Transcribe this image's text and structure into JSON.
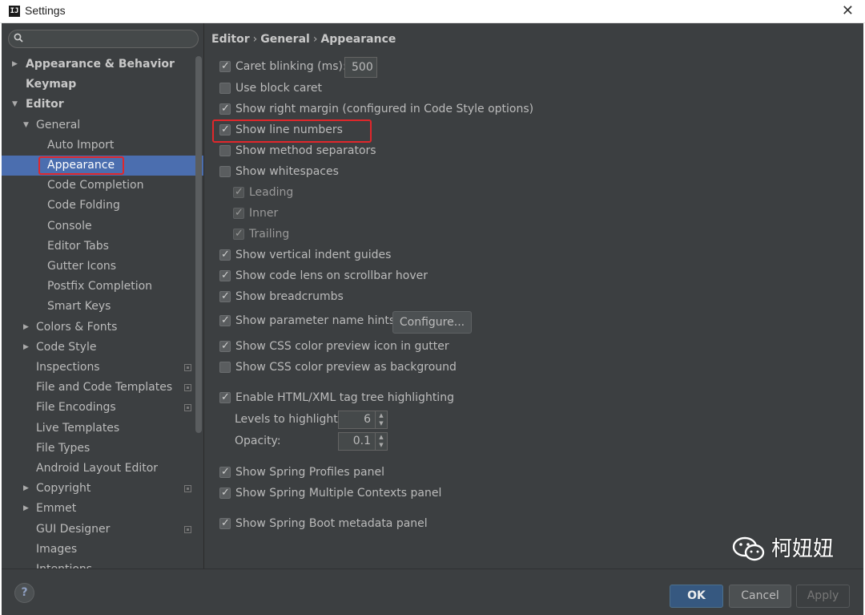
{
  "window": {
    "title": "Settings",
    "close_glyph": "✕",
    "app_icon_letter": "IJ"
  },
  "search": {
    "placeholder": "",
    "icon": "search-icon"
  },
  "sidebar": {
    "items": [
      {
        "label": "Appearance & Behavior",
        "level": 0,
        "arrow": "▶",
        "bold": true
      },
      {
        "label": "Keymap",
        "level": 0,
        "arrow": "",
        "bold": true
      },
      {
        "label": "Editor",
        "level": 0,
        "arrow": "▼",
        "bold": true
      },
      {
        "label": "General",
        "level": 1,
        "arrow": "▼"
      },
      {
        "label": "Auto Import",
        "level": 2,
        "arrow": ""
      },
      {
        "label": "Appearance",
        "level": 2,
        "arrow": "",
        "selected": true
      },
      {
        "label": "Code Completion",
        "level": 2,
        "arrow": ""
      },
      {
        "label": "Code Folding",
        "level": 2,
        "arrow": ""
      },
      {
        "label": "Console",
        "level": 2,
        "arrow": ""
      },
      {
        "label": "Editor Tabs",
        "level": 2,
        "arrow": ""
      },
      {
        "label": "Gutter Icons",
        "level": 2,
        "arrow": ""
      },
      {
        "label": "Postfix Completion",
        "level": 2,
        "arrow": ""
      },
      {
        "label": "Smart Keys",
        "level": 2,
        "arrow": ""
      },
      {
        "label": "Colors & Fonts",
        "level": 1,
        "arrow": "▶"
      },
      {
        "label": "Code Style",
        "level": 1,
        "arrow": "▶"
      },
      {
        "label": "Inspections",
        "level": 1,
        "arrow": "",
        "project_icon": true
      },
      {
        "label": "File and Code Templates",
        "level": 1,
        "arrow": "",
        "project_icon": true
      },
      {
        "label": "File Encodings",
        "level": 1,
        "arrow": "",
        "project_icon": true
      },
      {
        "label": "Live Templates",
        "level": 1,
        "arrow": ""
      },
      {
        "label": "File Types",
        "level": 1,
        "arrow": ""
      },
      {
        "label": "Android Layout Editor",
        "level": 1,
        "arrow": ""
      },
      {
        "label": "Copyright",
        "level": 1,
        "arrow": "▶",
        "project_icon": true
      },
      {
        "label": "Emmet",
        "level": 1,
        "arrow": "▶"
      },
      {
        "label": "GUI Designer",
        "level": 1,
        "arrow": "",
        "project_icon": true
      },
      {
        "label": "Images",
        "level": 1,
        "arrow": ""
      },
      {
        "label": "Intentions",
        "level": 1,
        "arrow": ""
      }
    ]
  },
  "breadcrumb": {
    "parts": [
      "Editor",
      "General",
      "Appearance"
    ],
    "separator": "›"
  },
  "options": {
    "caret_blinking": {
      "label": "Caret blinking (ms):",
      "checked": true,
      "value": "500"
    },
    "use_block_caret": {
      "label": "Use block caret",
      "checked": false
    },
    "show_right_margin": {
      "label": "Show right margin (configured in Code Style options)",
      "checked": true
    },
    "show_line_numbers": {
      "label": "Show line numbers",
      "checked": true
    },
    "show_method_separators": {
      "label": "Show method separators",
      "checked": false
    },
    "show_whitespaces": {
      "label": "Show whitespaces",
      "checked": false
    },
    "leading": {
      "label": "Leading",
      "checked": true,
      "disabled": true
    },
    "inner": {
      "label": "Inner",
      "checked": true,
      "disabled": true
    },
    "trailing": {
      "label": "Trailing",
      "checked": true,
      "disabled": true
    },
    "vertical_indent_guides": {
      "label": "Show vertical indent guides",
      "checked": true
    },
    "code_lens": {
      "label": "Show code lens on scrollbar hover",
      "checked": true
    },
    "breadcrumbs": {
      "label": "Show breadcrumbs",
      "checked": true
    },
    "param_hints": {
      "label": "Show parameter name hints",
      "checked": true,
      "button": "Configure..."
    },
    "css_icon": {
      "label": "Show CSS color preview icon in gutter",
      "checked": true
    },
    "css_background": {
      "label": "Show CSS color preview as background",
      "checked": false
    },
    "tag_tree": {
      "label": "Enable HTML/XML tag tree highlighting",
      "checked": true
    },
    "levels": {
      "label": "Levels to highlight:",
      "value": "6"
    },
    "opacity": {
      "label": "Opacity:",
      "value": "0.1"
    },
    "spring_profiles": {
      "label": "Show Spring Profiles panel",
      "checked": true
    },
    "spring_contexts": {
      "label": "Show Spring Multiple Contexts panel",
      "checked": true
    },
    "spring_boot": {
      "label": "Show Spring Boot metadata panel",
      "checked": true
    }
  },
  "footer": {
    "help": "?",
    "ok": "OK",
    "cancel": "Cancel",
    "apply": "Apply"
  },
  "watermark": {
    "text": "柯妞妞"
  },
  "colors": {
    "background": "#3c3f41",
    "selection": "#4b6eaf",
    "highlight_box": "#e0272b",
    "ok_button": "#365880"
  }
}
